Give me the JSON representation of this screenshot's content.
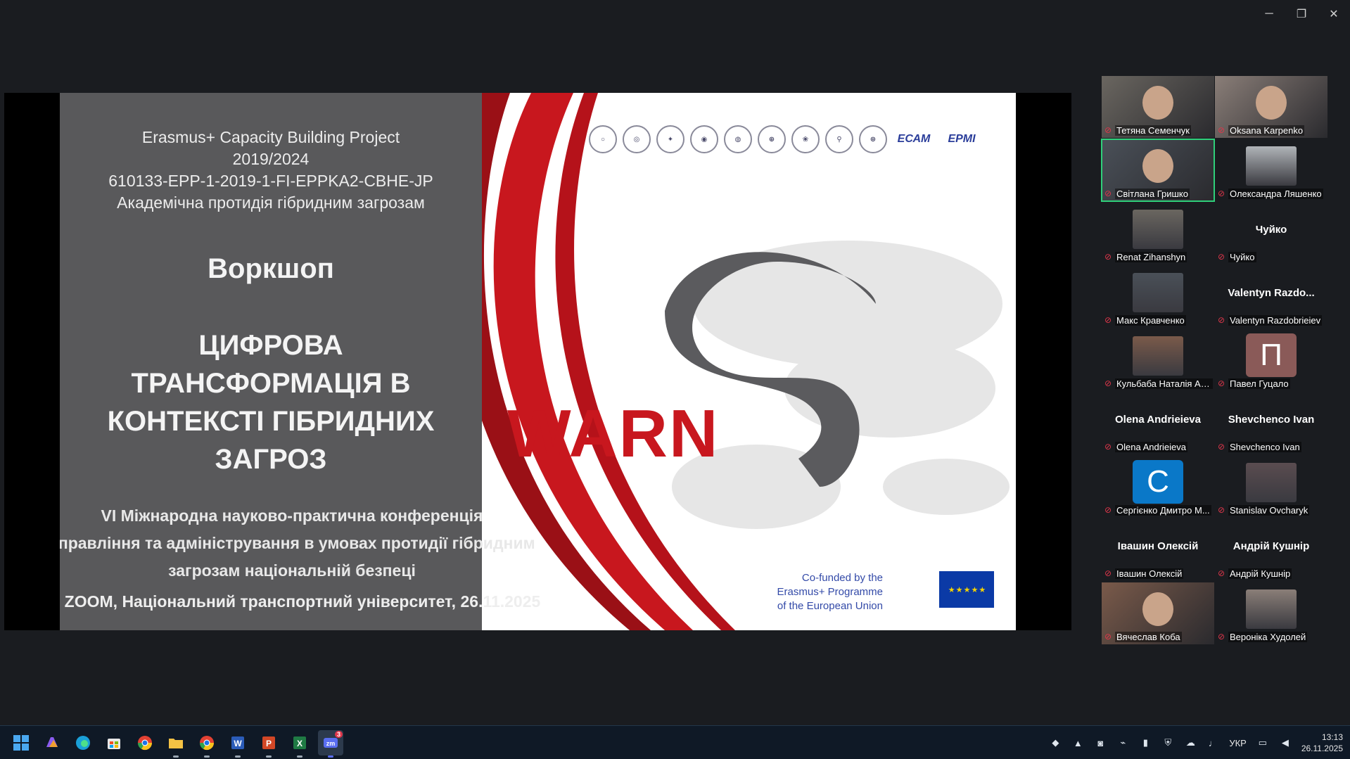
{
  "window_controls": {
    "minimize": "─",
    "restore": "❐",
    "close": "✕"
  },
  "slide": {
    "project_lines": [
      "Erasmus+ Capacity Building Project",
      "2019/2024",
      "610133-EPP-1-2019-1-FI-EPPKA2-CBHE-JP",
      "Академічна протидія гібридним загрозам"
    ],
    "workshop": "Воркшоп",
    "title_lines": [
      "ЦИФРОВА",
      "ТРАНСФОРМАЦІЯ В",
      "КОНТЕКСТІ ГІБРИДНИХ",
      "ЗАГРОЗ"
    ],
    "conference_lines": [
      "VI Міжнародна науково-практична конференція",
      "Управління та адміністрування в умовах протидії гібридним",
      "загрозам національній безпеці"
    ],
    "footer": "ZOOM, Національний транспортний університет, 26.11.2025",
    "logo_text": "WARN",
    "partner_logos": [
      "ЕСАМ",
      "ЕРМІ"
    ],
    "cofunded_lines": [
      "Co-funded by the",
      "Erasmus+ Programme",
      "of the European Union"
    ],
    "eu_stars": "★ ★ ★ ★ ★"
  },
  "participants": [
    {
      "label": "Тетяна Семенчук",
      "display": "",
      "type": "video"
    },
    {
      "label": "Oksana Karpenko",
      "display": "",
      "type": "video"
    },
    {
      "label": "Світлана Гришко",
      "display": "",
      "type": "video",
      "active": true
    },
    {
      "label": "Олександра Ляшенко",
      "display": "",
      "type": "photo"
    },
    {
      "label": "Renat Zihanshyn",
      "display": "",
      "type": "photo"
    },
    {
      "label": "Чуйко",
      "display": "Чуйко",
      "type": "name"
    },
    {
      "label": "Макс Кравченко",
      "display": "",
      "type": "photo"
    },
    {
      "label": "Valentyn Razdobrieiev",
      "display": "Valentyn  Razdo...",
      "type": "name"
    },
    {
      "label": "Кульбаба Наталія Ан...",
      "display": "",
      "type": "photo"
    },
    {
      "label": "Павел Гуцало",
      "display": "П",
      "type": "letter",
      "color": "#8a5a58"
    },
    {
      "label": "Olena Andrieieva",
      "display": "Olena Andrieieva",
      "type": "name"
    },
    {
      "label": "Shevchenco Ivan",
      "display": "Shevchenco Ivan",
      "type": "name"
    },
    {
      "label": "Сергієнко Дмитро М...",
      "display": "С",
      "type": "letter",
      "color": "#0a78c8"
    },
    {
      "label": "Stanislav Ovcharyk",
      "display": "",
      "type": "photo"
    },
    {
      "label": "Івашин Олексій",
      "display": "Івашин Олексій",
      "type": "name"
    },
    {
      "label": "Андрій Кушнір",
      "display": "Андрій Кушнір",
      "type": "name"
    },
    {
      "label": "Вячеслав Коба",
      "display": "",
      "type": "video"
    },
    {
      "label": "Вероніка Худолей",
      "display": "",
      "type": "photo"
    }
  ],
  "taskbar": {
    "apps": [
      "start",
      "copilot",
      "edge",
      "store",
      "chrome",
      "explorer",
      "chrome-profile",
      "word",
      "powerpoint",
      "excel",
      "zoom"
    ],
    "zoom_badge": "3",
    "language": "УКР",
    "time": "13:13",
    "date": "26.11.2025"
  }
}
